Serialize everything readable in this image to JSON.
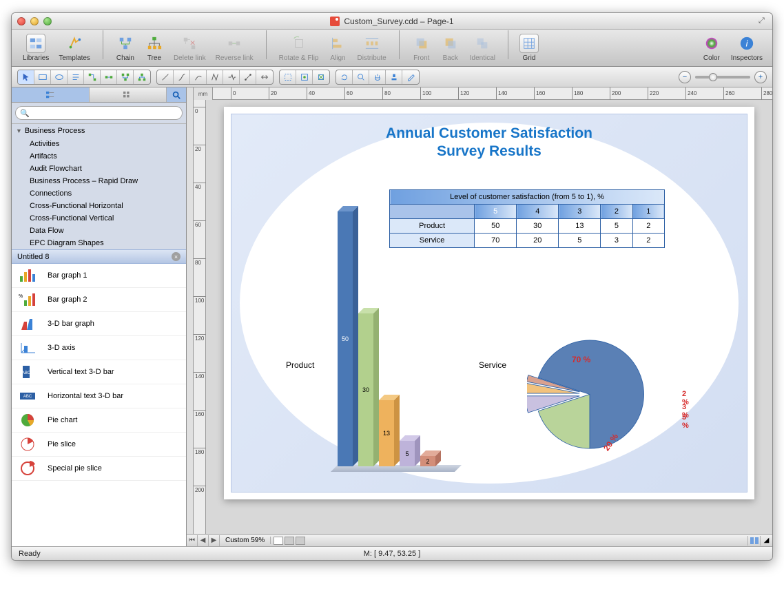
{
  "window": {
    "title": "Custom_Survey.cdd – Page-1"
  },
  "toolbar": {
    "libraries": "Libraries",
    "templates": "Templates",
    "chain": "Chain",
    "tree": "Tree",
    "delete_link": "Delete link",
    "reverse_link": "Reverse link",
    "rotate_flip": "Rotate & Flip",
    "align": "Align",
    "distribute": "Distribute",
    "front": "Front",
    "back": "Back",
    "identical": "Identical",
    "grid": "Grid",
    "color": "Color",
    "inspectors": "Inspectors"
  },
  "sidebar": {
    "search_placeholder": "",
    "category": "Business Process",
    "items": [
      "Activities",
      "Artifacts",
      "Audit Flowchart",
      "Business Process – Rapid Draw",
      "Connections",
      "Cross-Functional Horizontal",
      "Cross-Functional Vertical",
      "Data Flow",
      "EPC Diagram Shapes"
    ],
    "open_tab": "Untitled 8",
    "shapes": [
      "Bar graph   1",
      "Bar graph   2",
      "3-D bar graph",
      "3-D axis",
      "Vertical text 3-D bar",
      "Horizontal text 3-D bar",
      "Pie chart",
      "Pie slice",
      "Special pie slice"
    ]
  },
  "ruler_unit": "mm",
  "hruler_ticks": [
    "0",
    "20",
    "40",
    "60",
    "80",
    "100",
    "120",
    "140",
    "160",
    "180",
    "200",
    "220",
    "240",
    "260",
    "280"
  ],
  "vruler_ticks": [
    "0",
    "20",
    "40",
    "60",
    "80",
    "100",
    "120",
    "140",
    "160",
    "180",
    "200"
  ],
  "document": {
    "title_line1": "Annual Customer Satisfaction",
    "title_line2": "Survey Results",
    "table": {
      "header": "Level of customer satisfaction (from 5 to 1), %",
      "levels": [
        "5",
        "4",
        "3",
        "2",
        "1"
      ],
      "rows": [
        {
          "label": "Product",
          "values": [
            "50",
            "30",
            "13",
            "5",
            "2"
          ]
        },
        {
          "label": "Service",
          "values": [
            "70",
            "20",
            "5",
            "3",
            "2"
          ]
        }
      ]
    },
    "bar_label": "Product",
    "pie_label": "Service"
  },
  "status": {
    "ready": "Ready",
    "mouse": "M: [ 9.47, 53.25 ]"
  },
  "zoom_label": "Custom 59%",
  "chart_data": [
    {
      "type": "bar",
      "title": "Product",
      "categories": [
        "5",
        "4",
        "3",
        "2",
        "1"
      ],
      "values": [
        50,
        30,
        13,
        5,
        2
      ],
      "ylim": [
        0,
        50
      ]
    },
    {
      "type": "pie",
      "title": "Service",
      "series": [
        {
          "name": "5",
          "value": 70
        },
        {
          "name": "4",
          "value": 20
        },
        {
          "name": "3",
          "value": 5
        },
        {
          "name": "2",
          "value": 3
        },
        {
          "name": "1",
          "value": 2
        }
      ],
      "labels": [
        "70 %",
        "20 %",
        "5 %",
        "3 %",
        "2 %"
      ]
    }
  ]
}
